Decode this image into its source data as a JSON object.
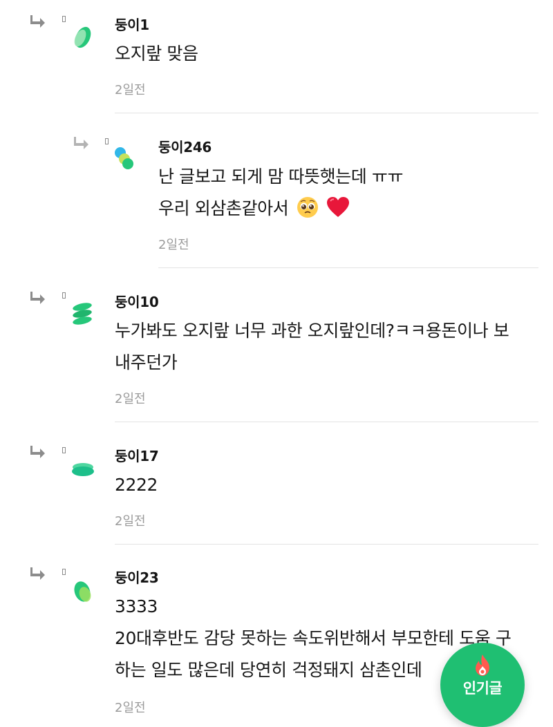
{
  "comments": [
    {
      "nickname": "둥이1",
      "lines": [
        "오지랖 맞음"
      ],
      "time": "2일전"
    },
    {
      "nickname": "둥이246",
      "lines": [
        "난 글보고 되게 맘 따뜻햇는데 ㅠㅠ",
        "우리 외삼촌같아서"
      ],
      "time": "2일전",
      "emojis": [
        "pleading-face-emoji",
        "red-heart-emoji"
      ]
    },
    {
      "nickname": "둥이10",
      "lines": [
        "누가봐도 오지랖 너무 과한 오지랖인데?ㅋㅋ용돈이나 보",
        "내주던가"
      ],
      "time": "2일전"
    },
    {
      "nickname": "둥이17",
      "lines": [
        "2222"
      ],
      "time": "2일전"
    },
    {
      "nickname": "둥이23",
      "lines": [
        "3333",
        "20대후반도 감당 못하는 속도위반해서 부모한테 도움 구",
        "하는 일도 많은데 당연히 걱정돼지 삼촌인데"
      ],
      "time": "2일전"
    }
  ],
  "fab": {
    "label": "인기글",
    "icon": "fire-icon",
    "color": "#1fbf72"
  },
  "colors": {
    "avatar_green": "#2ecc71",
    "time_gray": "#9b9b9b",
    "divider": "#e3e3e3"
  }
}
